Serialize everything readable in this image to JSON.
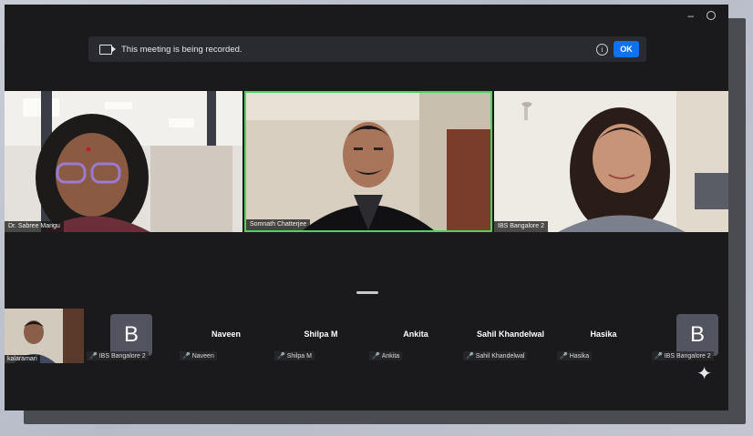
{
  "recording_banner": {
    "text": "This meeting is being recorded.",
    "ok_label": "OK",
    "info_glyph": "i"
  },
  "window_controls": {
    "minimize": "–",
    "restore": "⬤"
  },
  "video_tiles": [
    {
      "name": "Dr. Sabree Mangu"
    },
    {
      "name": "Somnath Chatterjee"
    },
    {
      "name": "IBS Bangalore 2"
    }
  ],
  "strip": {
    "thumb_name": "kalaramari",
    "avatar_left": {
      "letter": "B",
      "name": "IBS Bangalore 2"
    },
    "participants": [
      {
        "label": "Naveen",
        "tag": "Naveen"
      },
      {
        "label": "Shilpa M",
        "tag": "Shilpa M"
      },
      {
        "label": "Ankita",
        "tag": "Ankita"
      },
      {
        "label": "Sahil Khandelwal",
        "tag": "Sahil Khandelwal"
      },
      {
        "label": "Hasika",
        "tag": "Hasika"
      }
    ],
    "avatar_right": {
      "letter": "B",
      "name": "IBS Bangalore 2"
    },
    "mute_glyph": "🎤"
  },
  "colors": {
    "active_speaker": "#4fd25f",
    "ok_button": "#0e72ed",
    "muted": "#e23c3c"
  }
}
